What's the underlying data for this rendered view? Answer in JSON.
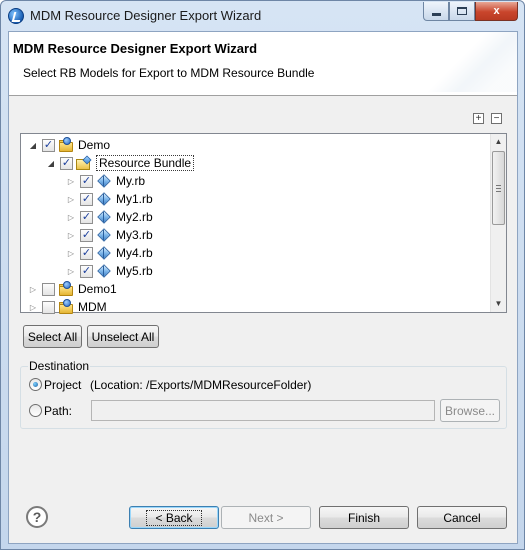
{
  "window": {
    "title": "MDM Resource Designer Export Wizard",
    "controls": {
      "minimize": "minimize",
      "maximize": "maximize",
      "close": "x"
    }
  },
  "header": {
    "title": "MDM Resource Designer Export Wizard",
    "subtitle": "Select RB Models for Export to MDM Resource Bundle"
  },
  "tree_toolbar": {
    "expand_all": "+",
    "collapse_all": "−"
  },
  "tree": {
    "nodes": [
      {
        "label": "Demo",
        "checked": true,
        "expanded": true,
        "icon": "project-icon"
      },
      {
        "label": "Resource Bundle",
        "checked": true,
        "expanded": true,
        "icon": "resource-bundle-icon",
        "selected": true
      },
      {
        "label": "My.rb",
        "checked": true,
        "icon": "model-cube-icon"
      },
      {
        "label": "My1.rb",
        "checked": true,
        "icon": "model-cube-icon"
      },
      {
        "label": "My2.rb",
        "checked": true,
        "icon": "model-cube-icon"
      },
      {
        "label": "My3.rb",
        "checked": true,
        "icon": "model-cube-icon"
      },
      {
        "label": "My4.rb",
        "checked": true,
        "icon": "model-cube-icon"
      },
      {
        "label": "My5.rb",
        "checked": true,
        "icon": "model-cube-icon"
      },
      {
        "label": "Demo1",
        "checked": false,
        "expanded": false,
        "icon": "project-icon"
      },
      {
        "label": "MDM",
        "checked": false,
        "expanded": false,
        "icon": "project-icon"
      }
    ]
  },
  "selection_buttons": {
    "select_all": "Select All",
    "unselect_all": "Unselect All"
  },
  "destination": {
    "group_label": "Destination",
    "project_label": "Project",
    "project_location": "(Location: /Exports/MDMResourceFolder)",
    "project_selected": true,
    "path_label": "Path:",
    "path_value": "",
    "browse_label": "Browse..."
  },
  "footer": {
    "help": "?",
    "back": "< Back",
    "next": "Next >",
    "finish": "Finish",
    "cancel": "Cancel"
  }
}
